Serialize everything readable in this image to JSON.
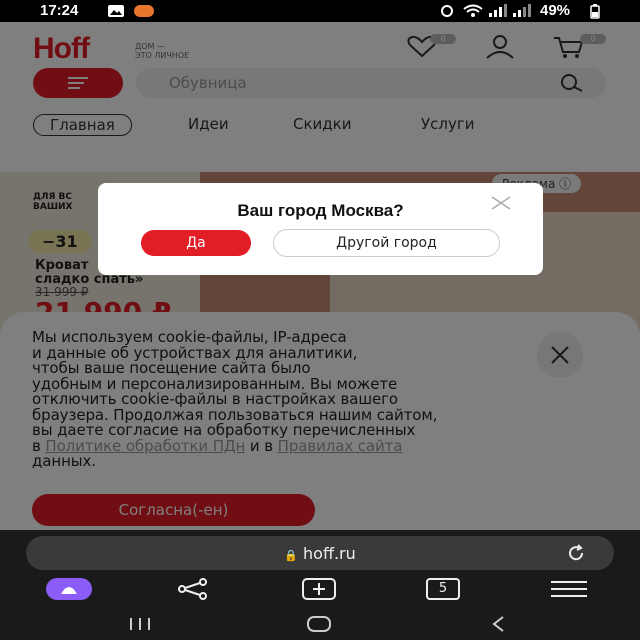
{
  "status_bar": {
    "time": "17:24",
    "battery": "49%"
  },
  "header": {
    "logo": "Hoff",
    "tagline_line1": "ДОМ —",
    "tagline_line2": "ЭТО ЛИЧНОЕ",
    "favorites_count": "0",
    "cart_count": "0",
    "search_placeholder": "Обувница"
  },
  "nav": [
    "Главная",
    "Идеи",
    "Скидки",
    "Услуги"
  ],
  "banner": {
    "small_line1": "ДЛЯ ВС",
    "small_line2": "ВАШИХ",
    "ad_label": "Реклама",
    "discount": "−31",
    "product_line1": "Кроват",
    "product_line2": "сладко спать»",
    "old_price": "31 999 ₽",
    "new_price": "21 990 ₽"
  },
  "dialog": {
    "title": "Ваш город Москва?",
    "yes": "Да",
    "other": "Другой город"
  },
  "cookie": {
    "l1": "Мы используем cookie-файлы, IP-адреса",
    "l2": "и данные об устройствах для аналитики,",
    "l3": "чтобы ваше посещение сайта было",
    "l4": "удобным и персонализированным. Вы можете",
    "l5": "отключить cookie-файлы в настройках вашего",
    "l6": "браузера. Продолжая пользоваться нашим сайтом,",
    "l7": "вы даете согласие на обработку перечисленных",
    "l8_a": "в ",
    "l8_link1": "Политике обработки ПДн",
    "l8_b": " и в ",
    "l8_link2": "Правилах сайта",
    "l9": "данных.",
    "agree": "Согласна(-ен)"
  },
  "browser": {
    "url": "hoff.ru",
    "tabs_count": "5"
  },
  "colors": {
    "brand": "#e11d26",
    "overlay": "rgba(0,0,0,0.5)"
  }
}
